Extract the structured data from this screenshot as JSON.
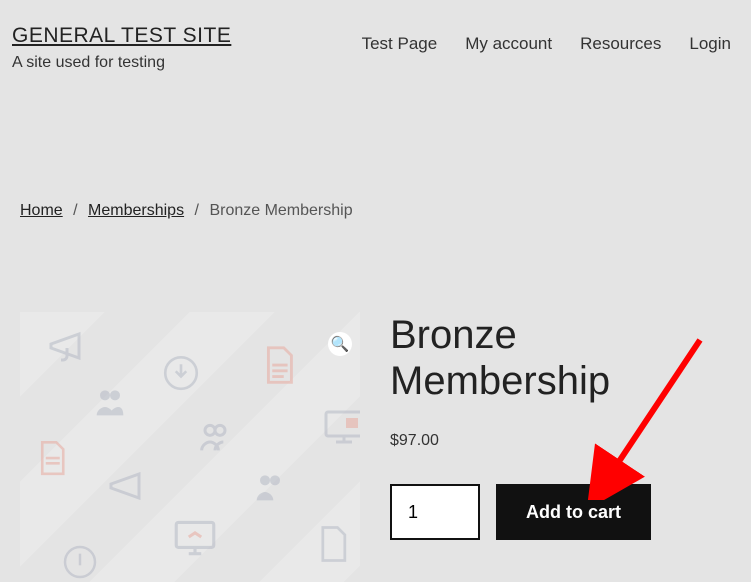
{
  "site": {
    "title": "GENERAL TEST SITE",
    "tagline": "A site used for testing"
  },
  "nav": {
    "items": [
      "Test Page",
      "My account",
      "Resources",
      "Login"
    ]
  },
  "breadcrumb": {
    "home": "Home",
    "category": "Memberships",
    "current": "Bronze Membership"
  },
  "product": {
    "title": "Bronze Membership",
    "price": "$97.00",
    "quantity": "1",
    "add_to_cart_label": "Add to cart"
  },
  "icons": {
    "zoom": "🔍"
  }
}
